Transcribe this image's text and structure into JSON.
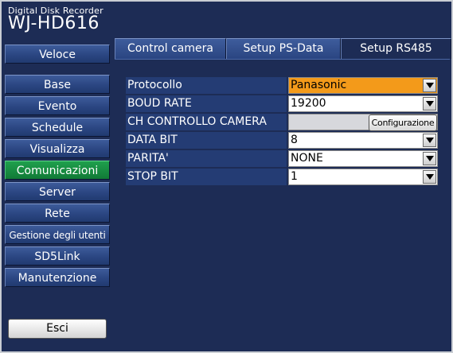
{
  "header": {
    "subtitle": "Digital Disk Recorder",
    "model": "WJ-HD616"
  },
  "sidebar": {
    "top_button": "Veloce",
    "items": [
      {
        "label": "Base"
      },
      {
        "label": "Evento"
      },
      {
        "label": "Schedule"
      },
      {
        "label": "Visualizza"
      },
      {
        "label": "Comunicazioni",
        "active": true
      },
      {
        "label": "Server"
      },
      {
        "label": "Rete"
      },
      {
        "label": "Gestione degli utenti"
      },
      {
        "label": "SD5Link"
      },
      {
        "label": "Manutenzione"
      }
    ],
    "exit_button": "Esci"
  },
  "tabs": [
    {
      "label": "Control camera"
    },
    {
      "label": "Setup PS-Data"
    },
    {
      "label": "Setup RS485",
      "active": true
    }
  ],
  "settings": {
    "protocol": {
      "label": "Protocollo",
      "value": "Panasonic"
    },
    "baud_rate": {
      "label": "BOUD RATE",
      "value": "19200"
    },
    "ch_control": {
      "label": "CH CONTROLLO CAMERA",
      "button": "Configurazione"
    },
    "data_bit": {
      "label": "DATA BIT",
      "value": "8"
    },
    "parity": {
      "label": "PARITA'",
      "value": "NONE"
    },
    "stop_bit": {
      "label": "STOP BIT",
      "value": "1"
    }
  },
  "colors": {
    "panel_bg": "#1d2c55",
    "active_nav": "#1a8f45",
    "highlight_field": "#f39a1a"
  },
  "icons": {
    "dropdown": "chevron-down-icon"
  }
}
